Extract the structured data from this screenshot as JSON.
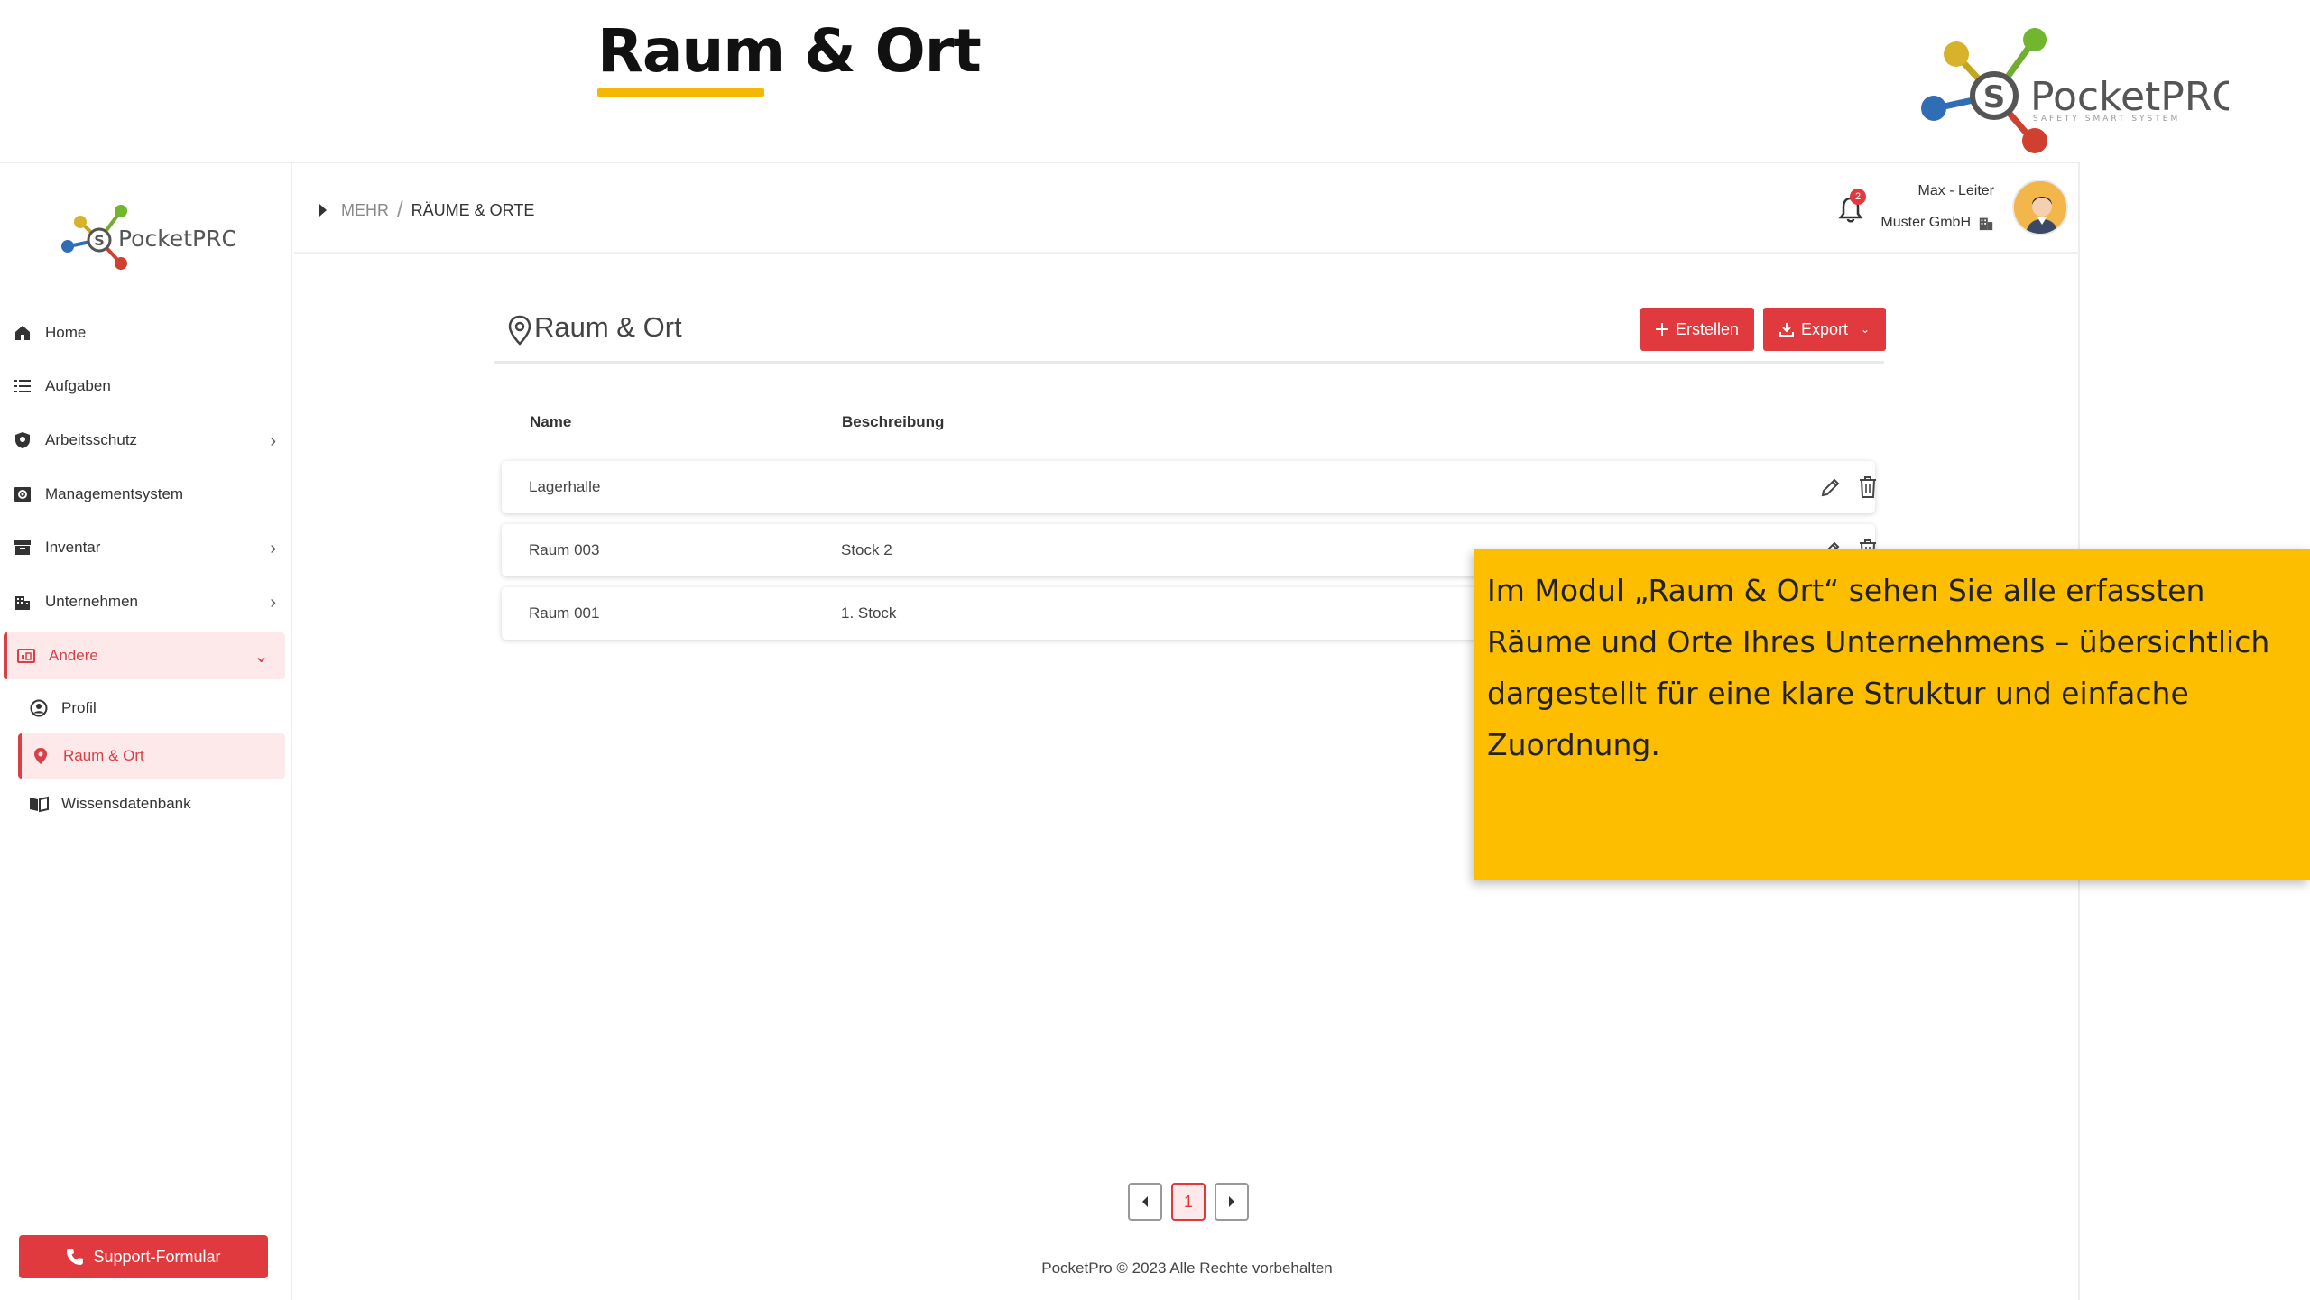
{
  "slide": {
    "title": "Raum & Ort"
  },
  "brand": {
    "name": "PocketPRO",
    "tagline": "SAFETY SMART SYSTEM",
    "accent": "#e0393e",
    "highlight": "#fdbe00"
  },
  "sidebar": {
    "items": [
      {
        "label": "Home",
        "icon": "home-icon"
      },
      {
        "label": "Aufgaben",
        "icon": "list-icon"
      },
      {
        "label": "Arbeitsschutz",
        "icon": "shield-icon",
        "expandable": true
      },
      {
        "label": "Managementsystem",
        "icon": "settings-box-icon"
      },
      {
        "label": "Inventar",
        "icon": "archive-icon",
        "expandable": true
      },
      {
        "label": "Unternehmen",
        "icon": "building-icon",
        "expandable": true
      },
      {
        "label": "Andere",
        "icon": "other-icon",
        "expanded": true
      }
    ],
    "subitems": [
      {
        "label": "Profil",
        "icon": "user-circle-icon"
      },
      {
        "label": "Raum & Ort",
        "icon": "location-pin-icon"
      },
      {
        "label": "Wissensdatenbank",
        "icon": "book-icon"
      }
    ],
    "support_label": "Support-Formular"
  },
  "topbar": {
    "breadcrumb": [
      "MEHR",
      "RÄUME & ORTE"
    ],
    "notifications": "2",
    "user_name": "Max - Leiter",
    "company": "Muster GmbH"
  },
  "panel": {
    "title": "Raum & Ort",
    "create_label": "Erstellen",
    "export_label": "Export",
    "columns": [
      "Name",
      "Beschreibung"
    ],
    "rows": [
      {
        "name": "Lagerhalle",
        "description": ""
      },
      {
        "name": "Raum 003",
        "description": "Stock 2"
      },
      {
        "name": "Raum 001",
        "description": "1. Stock"
      }
    ]
  },
  "pagination": {
    "current": "1"
  },
  "footer": "PocketPro © 2023 Alle Rechte vorbehalten",
  "callout": "Im Modul „Raum & Ort“ sehen Sie alle erfassten Räume und Orte Ihres Unternehmens – übersichtlich dargestellt für eine klare Struktur und einfache Zuordnung."
}
